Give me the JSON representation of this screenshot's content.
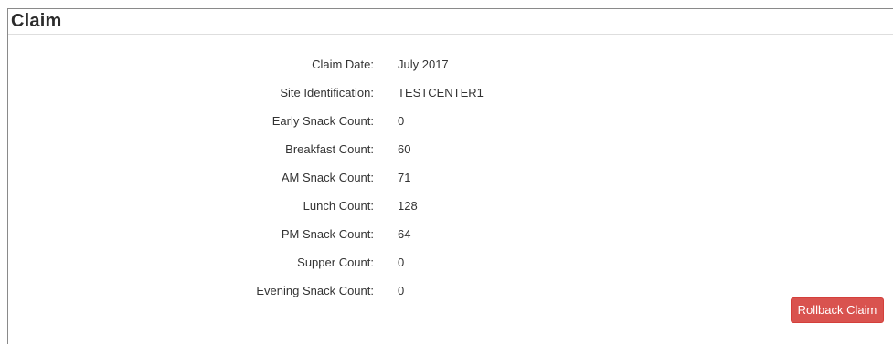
{
  "panel": {
    "title": "Claim"
  },
  "fields": [
    {
      "label": "Claim Date:",
      "value": "July 2017"
    },
    {
      "label": "Site Identification:",
      "value": "TESTCENTER1"
    },
    {
      "label": "Early Snack Count:",
      "value": "0"
    },
    {
      "label": "Breakfast Count:",
      "value": "60"
    },
    {
      "label": "AM Snack Count:",
      "value": "71"
    },
    {
      "label": "Lunch Count:",
      "value": "128"
    },
    {
      "label": "PM Snack Count:",
      "value": "64"
    },
    {
      "label": "Supper Count:",
      "value": "0"
    },
    {
      "label": "Evening Snack Count:",
      "value": "0"
    }
  ],
  "actions": {
    "rollback_label": "Rollback Claim"
  },
  "colors": {
    "danger": "#d9534f"
  }
}
